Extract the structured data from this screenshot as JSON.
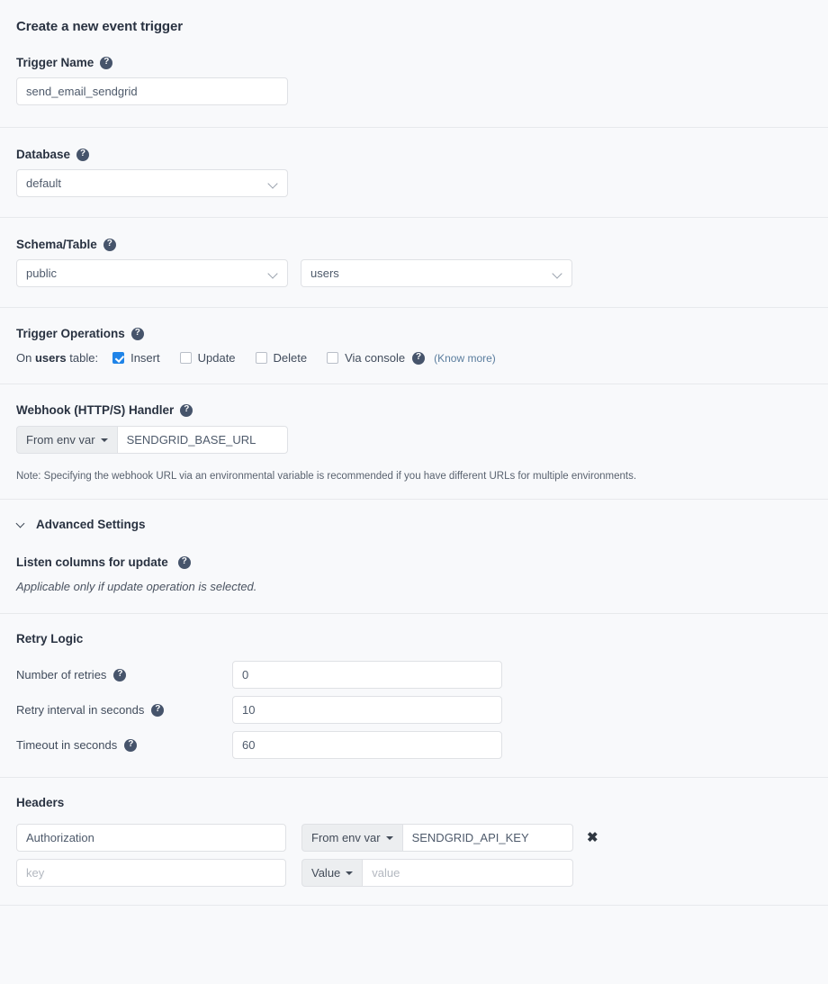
{
  "page": {
    "title": "Create a new event trigger"
  },
  "trigger_name": {
    "label": "Trigger Name",
    "value": "send_email_sendgrid"
  },
  "database": {
    "label": "Database",
    "value": "default"
  },
  "schema_table": {
    "label": "Schema/Table",
    "schema_value": "public",
    "table_value": "users"
  },
  "trigger_operations": {
    "label": "Trigger Operations",
    "prefix_before": "On ",
    "prefix_table": "users",
    "prefix_after": " table:",
    "options": [
      {
        "label": "Insert",
        "checked": true
      },
      {
        "label": "Update",
        "checked": false
      },
      {
        "label": "Delete",
        "checked": false
      },
      {
        "label": "Via console",
        "checked": false
      }
    ],
    "know_more": "(Know more)"
  },
  "webhook": {
    "label": "Webhook (HTTP/S) Handler",
    "mode_label": "From env var",
    "value": "SENDGRID_BASE_URL",
    "note": "Note: Specifying the webhook URL via an environmental variable is recommended if you have different URLs for multiple environments."
  },
  "advanced_settings": {
    "label": "Advanced Settings"
  },
  "listen_columns": {
    "label": "Listen columns for update",
    "note": "Applicable only if update operation is selected."
  },
  "retry_logic": {
    "label": "Retry Logic",
    "rows": [
      {
        "label": "Number of retries",
        "value": "0"
      },
      {
        "label": "Retry interval in seconds",
        "value": "10"
      },
      {
        "label": "Timeout in seconds",
        "value": "60"
      }
    ]
  },
  "headers": {
    "label": "Headers",
    "rows": [
      {
        "key_value": "Authorization",
        "key_is_placeholder": false,
        "mode_label": "From env var",
        "value": "SENDGRID_API_KEY",
        "value_is_placeholder": false,
        "has_remove": true,
        "remove_icon": "✖"
      },
      {
        "key_value": "key",
        "key_is_placeholder": true,
        "mode_label": "Value",
        "value": "value",
        "value_is_placeholder": true,
        "has_remove": false,
        "remove_icon": ""
      }
    ]
  },
  "icons": {
    "help": "?",
    "chevron_down": "chevron-down-icon",
    "caret_down": "caret-down-icon"
  },
  "colors": {
    "accent_checkbox": "#1f84e8",
    "link": "#5a7d9e",
    "page_bg": "#f8f9fb",
    "help_icon_bg": "#46546b"
  }
}
